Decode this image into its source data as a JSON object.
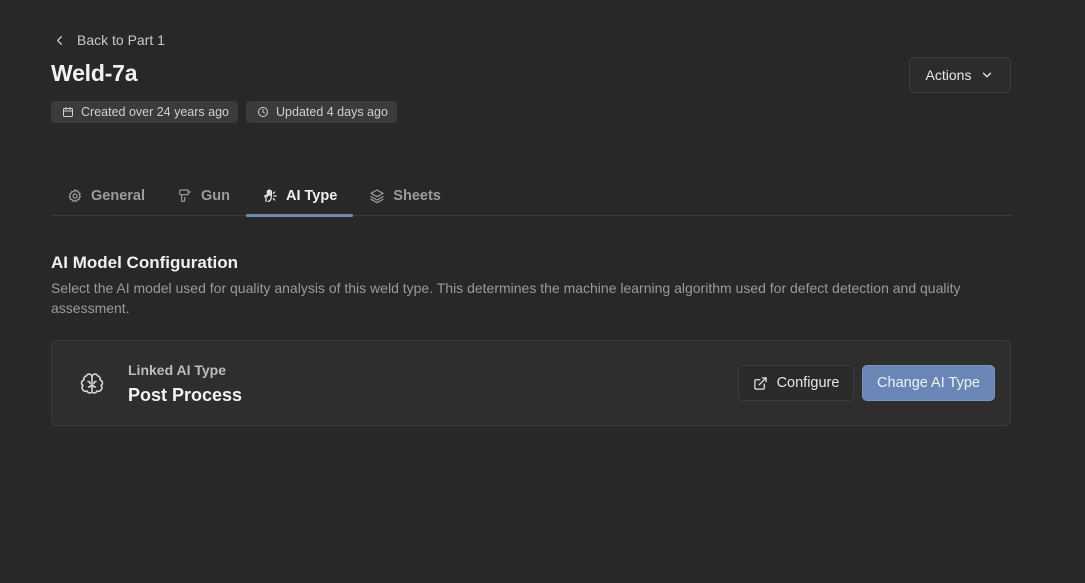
{
  "header": {
    "back_label": "Back to Part 1",
    "title": "Weld-7a",
    "created": "Created over 24 years ago",
    "updated": "Updated 4 days ago",
    "actions_label": "Actions"
  },
  "tabs": [
    {
      "label": "General",
      "icon": "gear-icon",
      "active": false
    },
    {
      "label": "Gun",
      "icon": "weld-gun-icon",
      "active": false
    },
    {
      "label": "AI Type",
      "icon": "hand-ai-icon",
      "active": true
    },
    {
      "label": "Sheets",
      "icon": "layers-icon",
      "active": false
    }
  ],
  "section": {
    "title": "AI Model Configuration",
    "description": "Select the AI model used for quality analysis of this weld type. This determines the machine learning algorithm used for defect detection and quality assessment."
  },
  "card": {
    "icon": "brain-icon",
    "label": "Linked AI Type",
    "value": "Post Process",
    "configure_label": "Configure",
    "change_label": "Change AI Type"
  },
  "colors": {
    "background": "#282828",
    "accent": "#6a86b6",
    "tab_indicator": "#6f88b3"
  }
}
